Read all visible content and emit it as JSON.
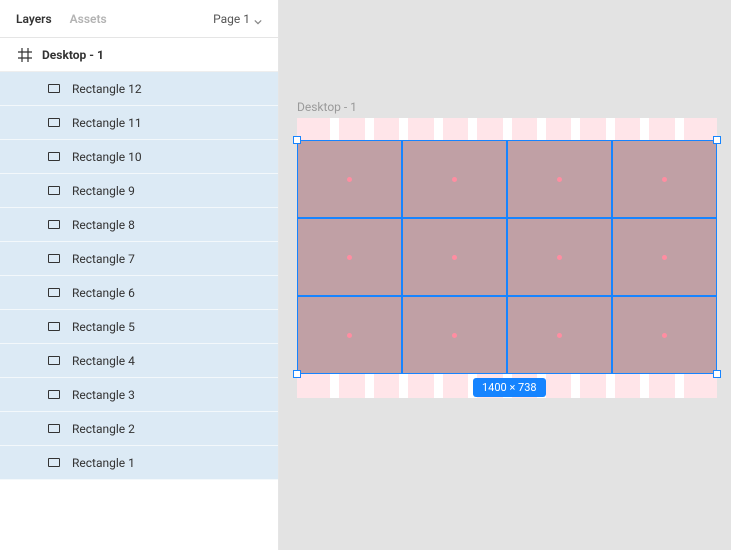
{
  "tabs": {
    "layers": "Layers",
    "assets": "Assets",
    "page_label": "Page 1"
  },
  "frame": {
    "name": "Desktop - 1"
  },
  "layers": [
    {
      "name": "Rectangle 12"
    },
    {
      "name": "Rectangle 11"
    },
    {
      "name": "Rectangle 10"
    },
    {
      "name": "Rectangle 9"
    },
    {
      "name": "Rectangle 8"
    },
    {
      "name": "Rectangle 7"
    },
    {
      "name": "Rectangle 6"
    },
    {
      "name": "Rectangle 5"
    },
    {
      "name": "Rectangle 4"
    },
    {
      "name": "Rectangle 3"
    },
    {
      "name": "Rectangle 2"
    },
    {
      "name": "Rectangle 1"
    }
  ],
  "canvas": {
    "artboard_label": "Desktop - 1",
    "selection_dims": "1400 × 738"
  }
}
